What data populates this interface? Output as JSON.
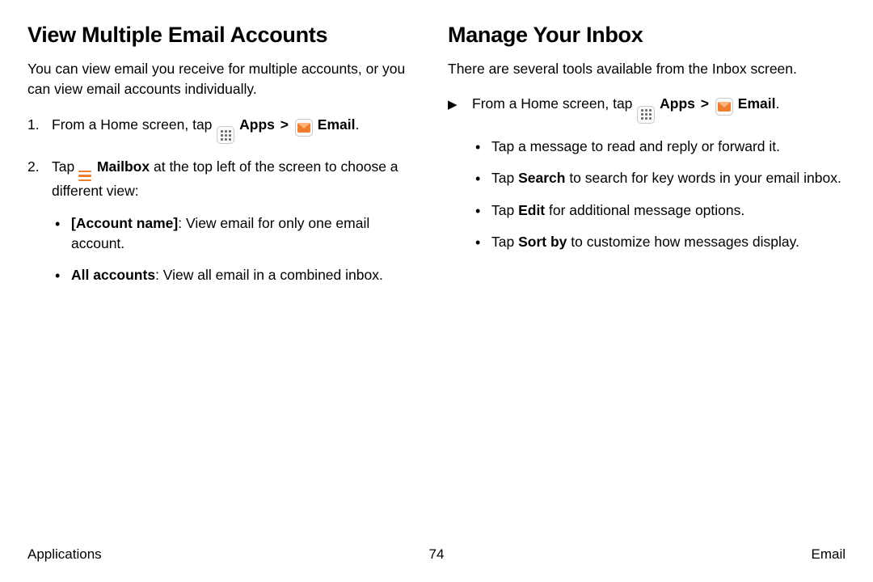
{
  "left": {
    "heading": "View Multiple Email Accounts",
    "intro": "You can view email you receive for multiple accounts, or you can view email accounts individually.",
    "step1_pre": "From a Home screen, tap ",
    "apps_label": "Apps",
    "chevron": ">",
    "email_label": "Email",
    "step2_pre": "Tap ",
    "mailbox_label": "Mailbox",
    "step2_post": " at the top left of the screen to choose a different view:",
    "sub1_bold": "[Account name]",
    "sub1_rest": ": View email for only one email account.",
    "sub2_bold": "All accounts",
    "sub2_rest": ": View all email in a combined inbox."
  },
  "right": {
    "heading": "Manage Your Inbox",
    "intro": "There are several tools available from the Inbox screen.",
    "arrow": "▶",
    "step_pre": "From a Home screen, tap ",
    "apps_label": "Apps",
    "chevron": ">",
    "email_label": "Email",
    "b1": "Tap a message to read and reply or forward it.",
    "b2_pre": "Tap ",
    "b2_bold": "Search",
    "b2_post": " to search for key words in your email inbox.",
    "b3_pre": "Tap ",
    "b3_bold": "Edit",
    "b3_post": " for additional message options.",
    "b4_pre": "Tap ",
    "b4_bold": "Sort by",
    "b4_post": " to customize how messages display."
  },
  "footer": {
    "left": "Applications",
    "page": "74",
    "right": "Email"
  }
}
